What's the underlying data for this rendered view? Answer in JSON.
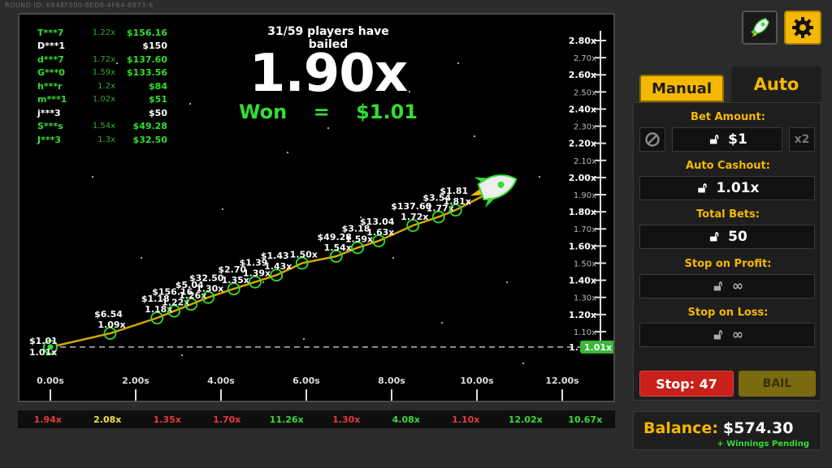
{
  "round_id": "ROUND ID: 6848F500-BED8-4F64-8B73-6",
  "players": [
    {
      "name": "T***7",
      "mult": "1.22x",
      "win": "$156.16",
      "name_green": true
    },
    {
      "name": "D***1",
      "mult": "",
      "win": "$150",
      "name_green": false
    },
    {
      "name": "d***7",
      "mult": "1.72x",
      "win": "$137.60",
      "name_green": true
    },
    {
      "name": "G***0",
      "mult": "1.59x",
      "win": "$133.56",
      "name_green": true
    },
    {
      "name": "h***r",
      "mult": "1.2x",
      "win": "$84",
      "name_green": true
    },
    {
      "name": "m***1",
      "mult": "1.02x",
      "win": "$51",
      "name_green": true
    },
    {
      "name": "j***3",
      "mult": "",
      "win": "$50",
      "name_green": false
    },
    {
      "name": "S***s",
      "mult": "1.54x",
      "win": "$49.28",
      "name_green": true
    },
    {
      "name": "J***3",
      "mult": "1.3x",
      "win": "$32.50",
      "name_green": true
    }
  ],
  "bailed_text": "31/59 players have bailed",
  "current_multiplier": "1.90x",
  "won": {
    "label": "Won",
    "eq": "=",
    "amount": "$1.01"
  },
  "y_ticks": [
    "2.80x",
    "2.70x",
    "2.60x",
    "2.50x",
    "2.40x",
    "2.30x",
    "2.20x",
    "2.10x",
    "2.00x",
    "1.90x",
    "1.80x",
    "1.70x",
    "1.60x",
    "1.50x",
    "1.40x",
    "1.30x",
    "1.20x",
    "1.10x",
    "1.00x"
  ],
  "x_ticks": [
    "0.00s",
    "2.00s",
    "4.00s",
    "6.00s",
    "8.00s",
    "10.00s",
    "12.00s"
  ],
  "start_marker": {
    "win": "$1.01",
    "mult": "1.01x"
  },
  "axis_badge": "1.01x",
  "cashouts": [
    {
      "t": 0.0,
      "m": 1.01,
      "win": "",
      "mult": ""
    },
    {
      "t": 1.4,
      "m": 1.09,
      "win": "$6.54",
      "mult": "1.09x"
    },
    {
      "t": 2.5,
      "m": 1.18,
      "win": "$1.18",
      "mult": "1.18x"
    },
    {
      "t": 2.9,
      "m": 1.22,
      "win": "$156.16",
      "mult": "1.22x"
    },
    {
      "t": 3.3,
      "m": 1.26,
      "win": "$5.04",
      "mult": "1.26x"
    },
    {
      "t": 3.7,
      "m": 1.3,
      "win": "$32.50",
      "mult": "1.30x"
    },
    {
      "t": 4.3,
      "m": 1.35,
      "win": "$2.70",
      "mult": "1.35x"
    },
    {
      "t": 4.8,
      "m": 1.39,
      "win": "$1.39",
      "mult": "1.39x"
    },
    {
      "t": 5.3,
      "m": 1.43,
      "win": "$1.43",
      "mult": "1.43x"
    },
    {
      "t": 5.9,
      "m": 1.5,
      "win": "",
      "mult": "1.50x"
    },
    {
      "t": 6.7,
      "m": 1.54,
      "win": "$49.28",
      "mult": "1.54x"
    },
    {
      "t": 7.2,
      "m": 1.59,
      "win": "$3.18",
      "mult": "1.59x"
    },
    {
      "t": 7.7,
      "m": 1.63,
      "win": "$13.04",
      "mult": "1.63x"
    },
    {
      "t": 8.5,
      "m": 1.72,
      "win": "$137.60",
      "mult": "1.72x"
    },
    {
      "t": 9.1,
      "m": 1.77,
      "win": "$3.54",
      "mult": "1.77x"
    },
    {
      "t": 9.5,
      "m": 1.81,
      "win": "$1.81",
      "mult": "1.81x"
    }
  ],
  "rocket_point": {
    "t": 10.2,
    "m": 1.9
  },
  "history": [
    {
      "value": "1.94x",
      "color": "#e83a3a"
    },
    {
      "value": "2.08x",
      "color": "#f2e24a"
    },
    {
      "value": "1.35x",
      "color": "#e83a3a"
    },
    {
      "value": "1.70x",
      "color": "#e83a3a"
    },
    {
      "value": "11.26x",
      "color": "#3ad83a"
    },
    {
      "value": "1.30x",
      "color": "#e83a3a"
    },
    {
      "value": "4.08x",
      "color": "#3ad83a"
    },
    {
      "value": "1.10x",
      "color": "#e83a3a"
    },
    {
      "value": "12.02x",
      "color": "#3ad83a"
    },
    {
      "value": "10.67x",
      "color": "#3ad83a"
    }
  ],
  "tabs": {
    "manual": "Manual",
    "auto": "Auto"
  },
  "bet_amount": {
    "label": "Bet Amount:",
    "value": "$1",
    "double": "x2"
  },
  "auto_cashout": {
    "label": "Auto Cashout:",
    "value": "1.01x"
  },
  "total_bets": {
    "label": "Total Bets:",
    "value": "50"
  },
  "stop_on_profit": {
    "label": "Stop on Profit:",
    "value": "∞"
  },
  "stop_on_loss": {
    "label": "Stop on Loss:",
    "value": "∞"
  },
  "stop_button": "Stop: 47",
  "bail_button": "BAIL",
  "balance": {
    "label": "Balance:",
    "value": "$574.30",
    "pending": "+ Winnings Pending"
  },
  "colors": {
    "accent": "#f5b800",
    "green": "#33dd33",
    "red": "#c8201a"
  }
}
